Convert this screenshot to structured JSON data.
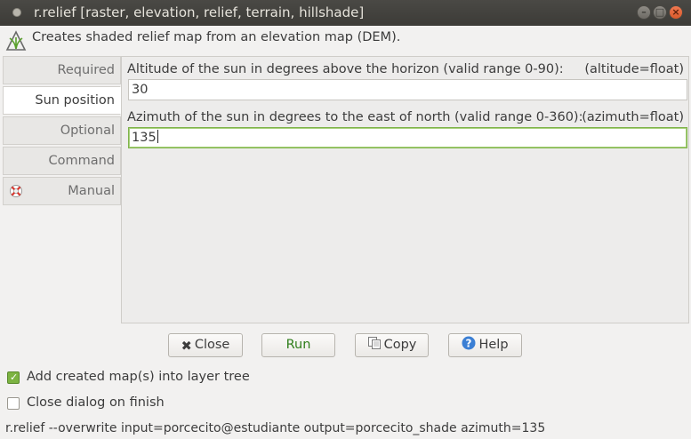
{
  "window": {
    "title": "r.relief [raster, elevation, relief, terrain, hillshade]"
  },
  "description": "Creates shaded relief map from an elevation map (DEM).",
  "tabs": [
    {
      "label": "Required",
      "active": false
    },
    {
      "label": "Sun position",
      "active": true
    },
    {
      "label": "Optional",
      "active": false
    },
    {
      "label": "Command output",
      "active": false
    },
    {
      "label": "Manual",
      "active": false,
      "icon": "lifebuoy-icon"
    }
  ],
  "params": {
    "altitude": {
      "label": "Altitude of the sun in degrees above the horizon (valid range 0-90):",
      "type_hint": "(altitude=float)",
      "value": "30"
    },
    "azimuth": {
      "label": "Azimuth of the sun in degrees to the east of north (valid range 0-360):",
      "type_hint": "(azimuth=float)",
      "value": "135"
    }
  },
  "buttons": {
    "close": "Close",
    "run": "Run",
    "copy": "Copy",
    "help": "Help"
  },
  "options": {
    "add_to_layer_tree": {
      "label": "Add created map(s) into layer tree",
      "checked": true
    },
    "close_on_finish": {
      "label": "Close dialog on finish",
      "checked": false
    }
  },
  "command": "r.relief --overwrite input=porcecito@estudiante output=porcecito_shade azimuth=135",
  "colors": {
    "accent_green": "#7cb342",
    "titlebar": "#3c3b37",
    "close_button": "#e95420"
  }
}
